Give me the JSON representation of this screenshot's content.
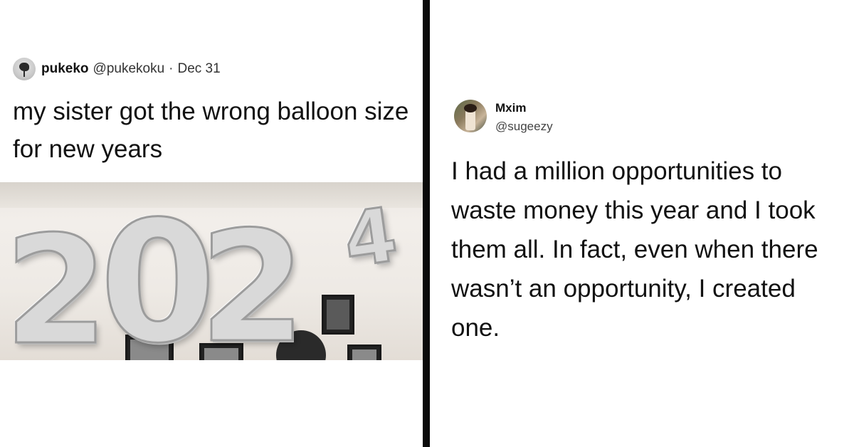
{
  "left_tweet": {
    "author_name": "pukeko",
    "handle": "@pukekoku",
    "separator": "·",
    "date": "Dec 31",
    "text": "my sister got the wrong balloon size for new years",
    "photo_digits": [
      "2",
      "0",
      "2",
      "4"
    ]
  },
  "right_tweet": {
    "author_name": "Mxim",
    "handle": "@sugeezy",
    "text": "I had a million opportunities to waste money this year and I took them all. In fact, even when there wasn’t an opportunity, I created one."
  },
  "colors": {
    "divider": "#0a0a0a",
    "background": "#ffffff",
    "text": "#111111"
  },
  "icons": [
    "pukeko-avatar",
    "mxim-avatar"
  ]
}
